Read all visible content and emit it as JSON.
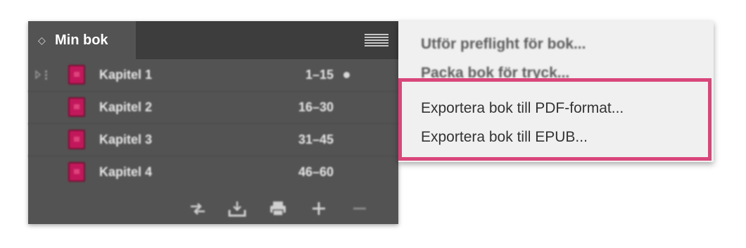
{
  "panel": {
    "title": "Min bok",
    "tab_arrows": "◇",
    "menu_icon": "hamburger-menu-icon",
    "documents": [
      {
        "label": "Kapitel 1",
        "pages": "1–15",
        "synced_source": true,
        "modified_dot": true
      },
      {
        "label": "Kapitel 2",
        "pages": "16–30",
        "synced_source": false,
        "modified_dot": false
      },
      {
        "label": "Kapitel 3",
        "pages": "31–45",
        "synced_source": false,
        "modified_dot": false
      },
      {
        "label": "Kapitel 4",
        "pages": "46–60",
        "synced_source": false,
        "modified_dot": false
      }
    ],
    "toolbar": [
      "synchronize-icon",
      "save-book-icon",
      "print-book-icon",
      "add-document-icon",
      "remove-document-icon"
    ]
  },
  "flyout_menu": {
    "items": [
      {
        "label": "Utför preflight för bok...",
        "dimmed": true
      },
      {
        "label": "Packa bok för tryck...",
        "dimmed": true
      },
      {
        "label": "Exportera bok till PDF-format...",
        "dimmed": false,
        "highlighted": true
      },
      {
        "label": "Exportera bok till EPUB...",
        "dimmed": false,
        "highlighted": true
      }
    ]
  },
  "colors": {
    "panel_bg": "#535353",
    "tabbar_bg": "#3d3d3d",
    "doc_icon": "#c2185b",
    "highlight": "#d9467a",
    "menu_bg": "#f0f0f0"
  }
}
